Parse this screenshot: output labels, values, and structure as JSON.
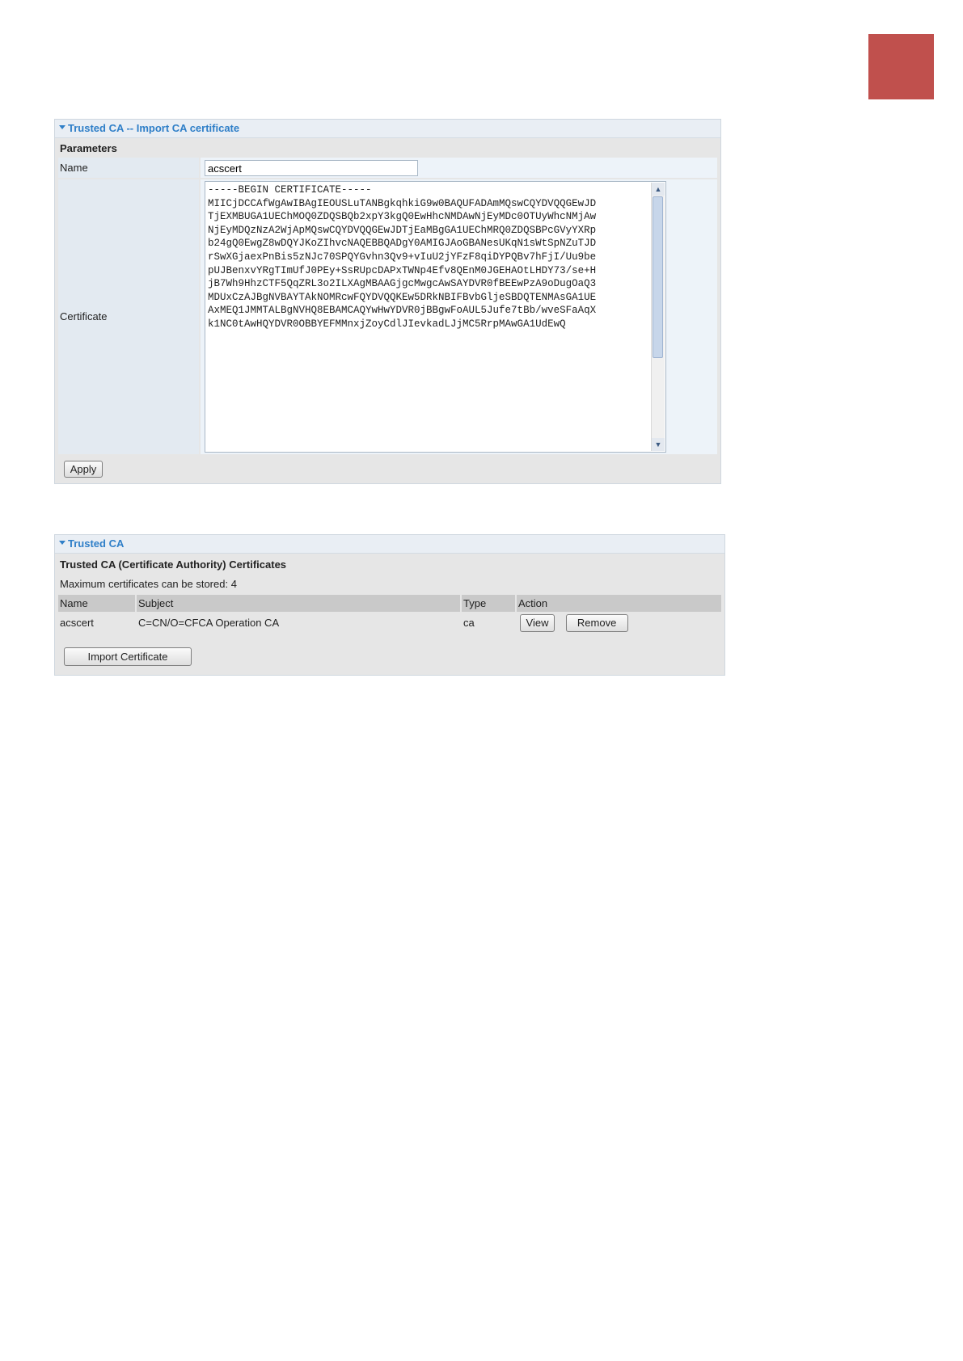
{
  "import_panel": {
    "title": "Trusted CA -- Import CA certificate",
    "section_label": "Parameters",
    "name_label": "Name",
    "name_value": "acscert",
    "certificate_label": "Certificate",
    "certificate_text": "-----BEGIN CERTIFICATE-----\nMIICjDCCAfWgAwIBAgIEOUSLuTANBgkqhkiG9w0BAQUFADAmMQswCQYDVQQGEwJD\nTjEXMBUGA1UEChMOQ0ZDQSBQb2xpY3kgQ0EwHhcNMDAwNjEyMDc0OTUyWhcNMjAw\nNjEyMDQzNzA2WjApMQswCQYDVQQGEwJDTjEaMBgGA1UEChMRQ0ZDQSBPcGVyYXRp\nb24gQ0EwgZ8wDQYJKoZIhvcNAQEBBQADgY0AMIGJAoGBANesUKqN1sWtSpNZuTJD\nrSwXGjaexPnBis5zNJc70SPQYGvhn3Qv9+vIuU2jYFzF8qiDYPQBv7hFjI/Uu9be\npUJBenxvYRgTImUfJ0PEy+SsRUpcDAPxTWNp4Efv8QEnM0JGEHAOtLHDY73/se+H\njB7Wh9HhzCTF5QqZRL3o2ILXAgMBAAGjgcMwgcAwSAYDVR0fBEEwPzA9oDugOaQ3\nMDUxCzAJBgNVBAYTAkNOMRcwFQYDVQQKEw5DRkNBIFBvbGljeSBDQTENMAsGA1UE\nAxMEQ1JMMTALBgNVHQ8EBAMCAQYwHwYDVR0jBBgwFoAUL5Jufe7tBb/wveSFaAqX\nk1NC0tAwHQYDVR0OBBYEFMMnxjZoyCdlJIevkadLJjMC5RrpMAwGA1UdEwQ",
    "apply_label": "Apply"
  },
  "trusted_panel": {
    "title": "Trusted CA",
    "section_label": "Trusted CA (Certificate Authority) Certificates",
    "max_text": "Maximum certificates can be stored: 4",
    "columns": [
      "Name",
      "Subject",
      "Type",
      "Action"
    ],
    "rows": [
      {
        "name": "acscert",
        "subject": "C=CN/O=CFCA Operation CA",
        "type": "ca",
        "view_label": "View",
        "remove_label": "Remove"
      }
    ],
    "import_label": "Import Certificate"
  },
  "colors": {
    "corner_block": "#c0504d",
    "title_blue": "#2f7fc8",
    "panel_bg": "#e6e6e6",
    "header_bg": "#c9c9c9"
  },
  "icons": {
    "scroll_up": "triangle-up-icon",
    "scroll_down": "triangle-down-icon",
    "panel_toggle": "triangle-down-icon"
  }
}
